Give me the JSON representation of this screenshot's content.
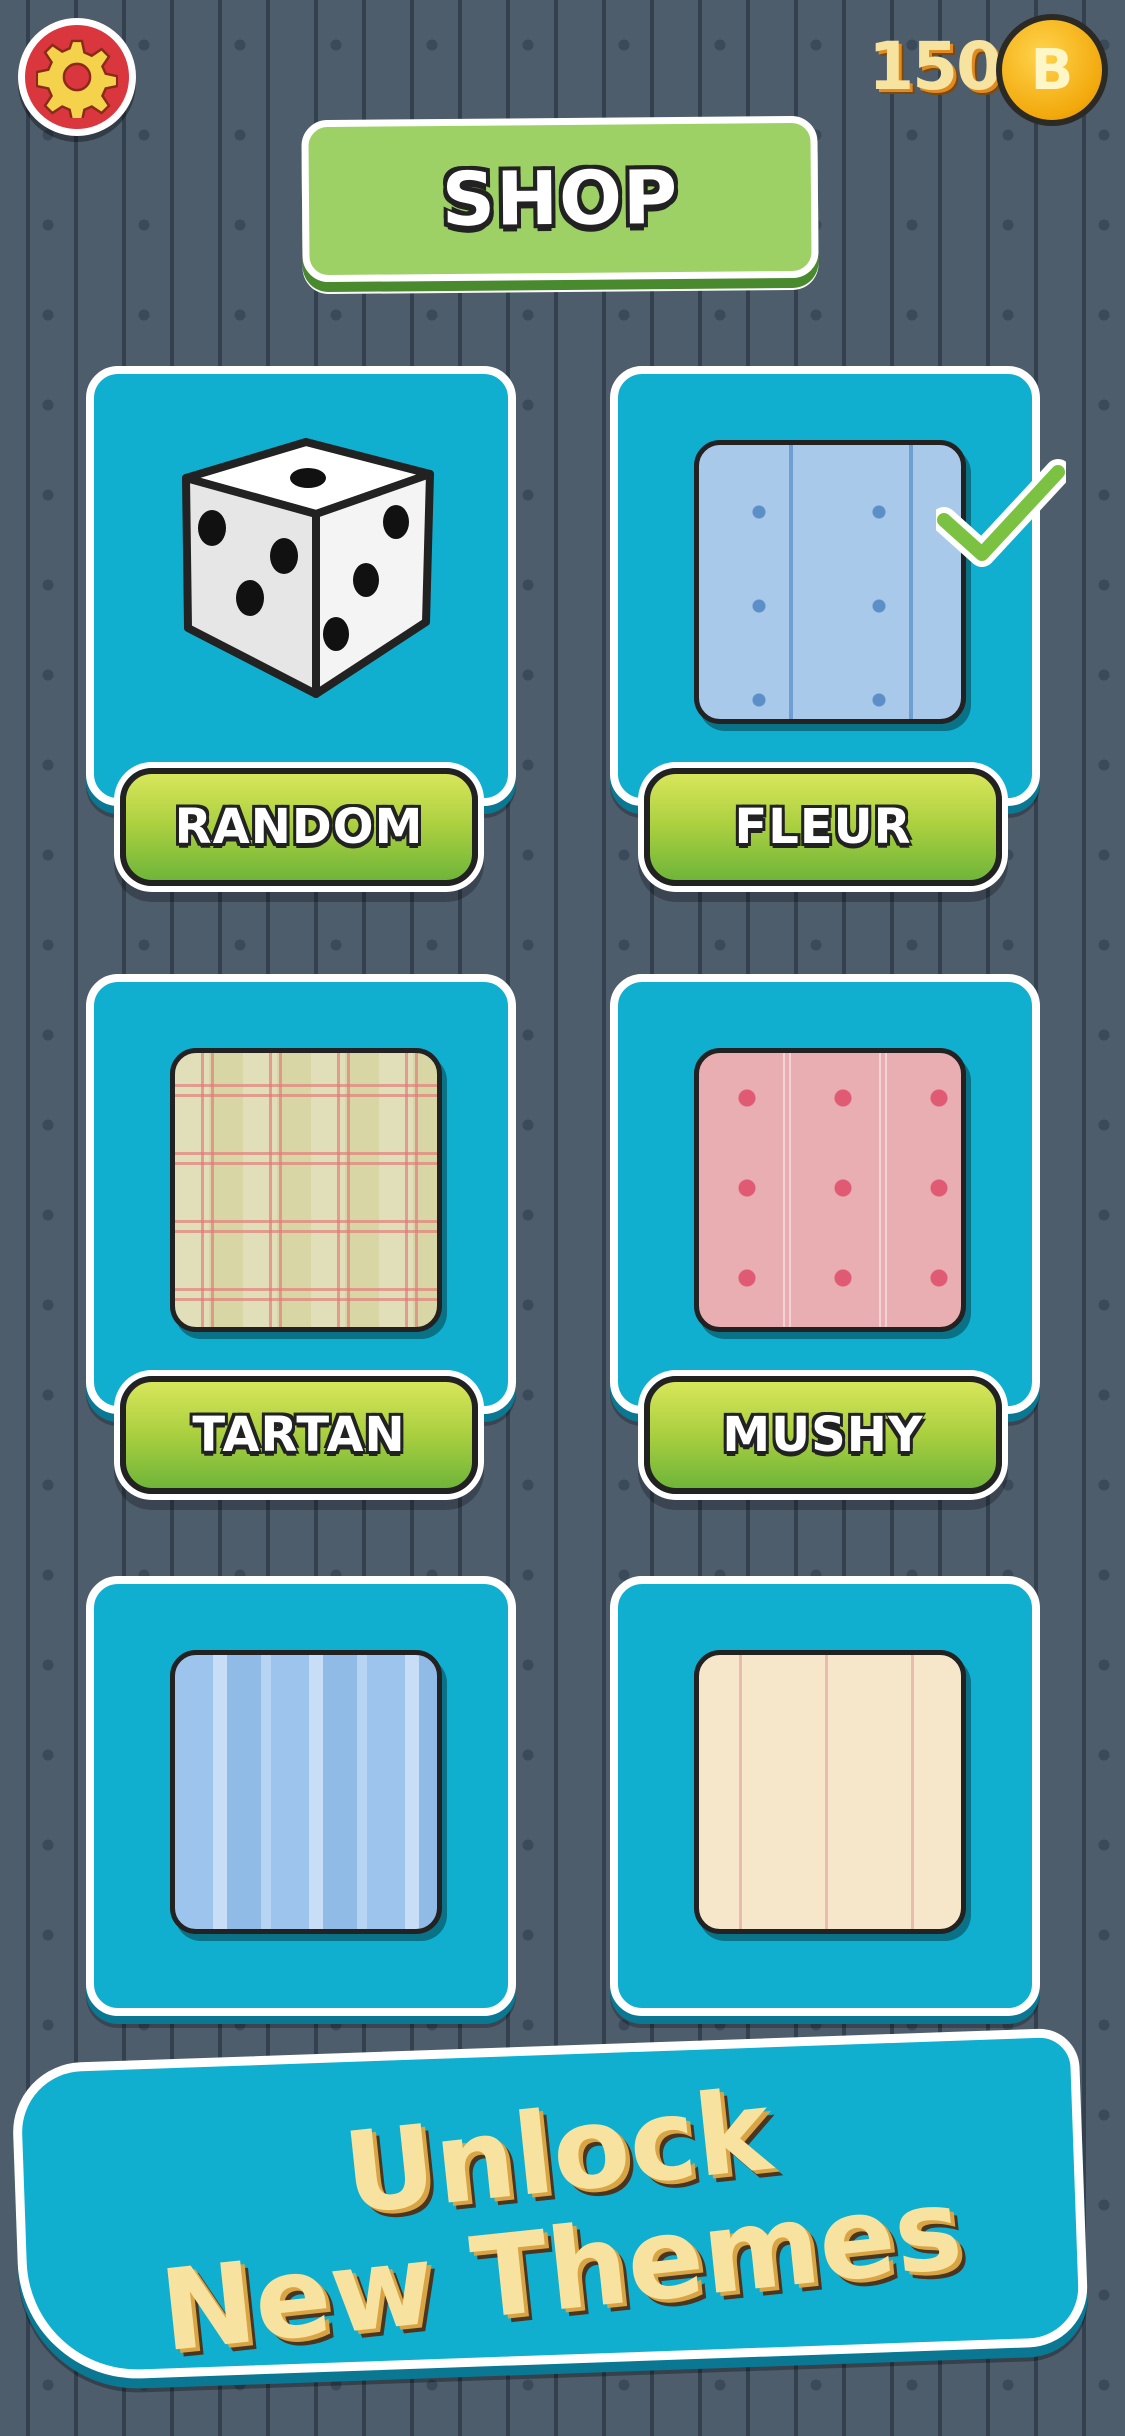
{
  "header": {
    "settings_icon": "gear-icon",
    "coins": "150",
    "coin_symbol": "B",
    "title": "SHOP"
  },
  "themes": [
    {
      "label": "RANDOM",
      "icon": "dice-icon"
    },
    {
      "label": "FLEUR",
      "selected": true,
      "icon": "fleur-pattern"
    },
    {
      "label": "TARTAN",
      "icon": "tartan-pattern"
    },
    {
      "label": "MUSHY",
      "icon": "heart-pattern"
    },
    {
      "label": "",
      "icon": "blue-stripes-pattern"
    },
    {
      "label": "",
      "icon": "chevron-pattern"
    }
  ],
  "banner": {
    "line1": "Unlock",
    "line2": "New Themes"
  },
  "colors": {
    "background": "#4e5d6c",
    "card": "#10afd0",
    "button_green": "#a9cf3f",
    "coin": "#f2a90c",
    "banner_text": "#f7e2a0"
  }
}
